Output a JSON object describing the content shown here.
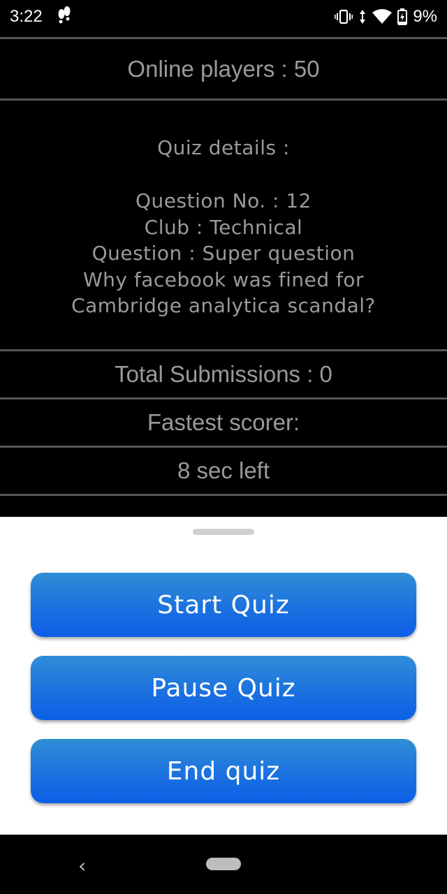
{
  "status_bar": {
    "time": "3:22",
    "battery": "9%",
    "icons": [
      "footprints-icon",
      "vibrate-icon",
      "data-arrows-icon",
      "wifi-icon",
      "battery-charging-icon"
    ]
  },
  "content": {
    "online_players": "Online players : 50",
    "quiz": {
      "heading": "Quiz details :",
      "question_no": "Question No. : 12",
      "club": "Club : Technical",
      "question": "Question : Super question",
      "question_text_line1": "Why facebook was fined for",
      "question_text_line2": "Cambridge analytica scandal?"
    },
    "total_submissions": "Total Submissions : 0",
    "fastest_scorer": "Fastest scorer:",
    "time_left": "8 sec left"
  },
  "sheet": {
    "buttons": {
      "start": "Start Quiz",
      "pause": "Pause Quiz",
      "end": "End quiz"
    },
    "button_color": "#1a6fe0"
  },
  "nav": {
    "back_glyph": "‹",
    "icons": [
      "back-icon",
      "home-pill-icon"
    ]
  }
}
